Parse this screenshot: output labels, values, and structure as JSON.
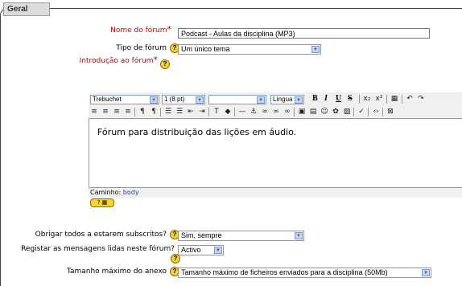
{
  "section": {
    "legend": "Geral"
  },
  "fields": {
    "forum_name": {
      "label": "Nome do fórum",
      "required_mark": "*",
      "value": "Podcast - Aulas da disciplina (MP3)"
    },
    "forum_type": {
      "label": "Tipo de fórum",
      "value": "Um único tema"
    },
    "intro": {
      "label": "Introdução ao fórum",
      "required_mark": "*"
    },
    "force_subscribe": {
      "label": "Obrigar todos a estarem subscritos?",
      "value": "Sim, sempre"
    },
    "track_read": {
      "label": "Registar as mensagens lidas neste fórum?",
      "value": "Activo"
    },
    "max_attachment": {
      "label": "Tamanho máximo do anexo",
      "value": "Tamanho máximo de ficheiros enviados para a disciplina (50Mb)"
    }
  },
  "editor": {
    "font": "Trebuchet",
    "size": "1 (8 pt)",
    "format": "",
    "language": "Língua",
    "content": "Fórum para distribuição das lições em áudio.",
    "path_label": "Caminho:",
    "path_value": "body"
  },
  "colors": {
    "required": "#cc0000",
    "help": "#f3d23a",
    "toolbar_bg": "#f0f0ee"
  }
}
